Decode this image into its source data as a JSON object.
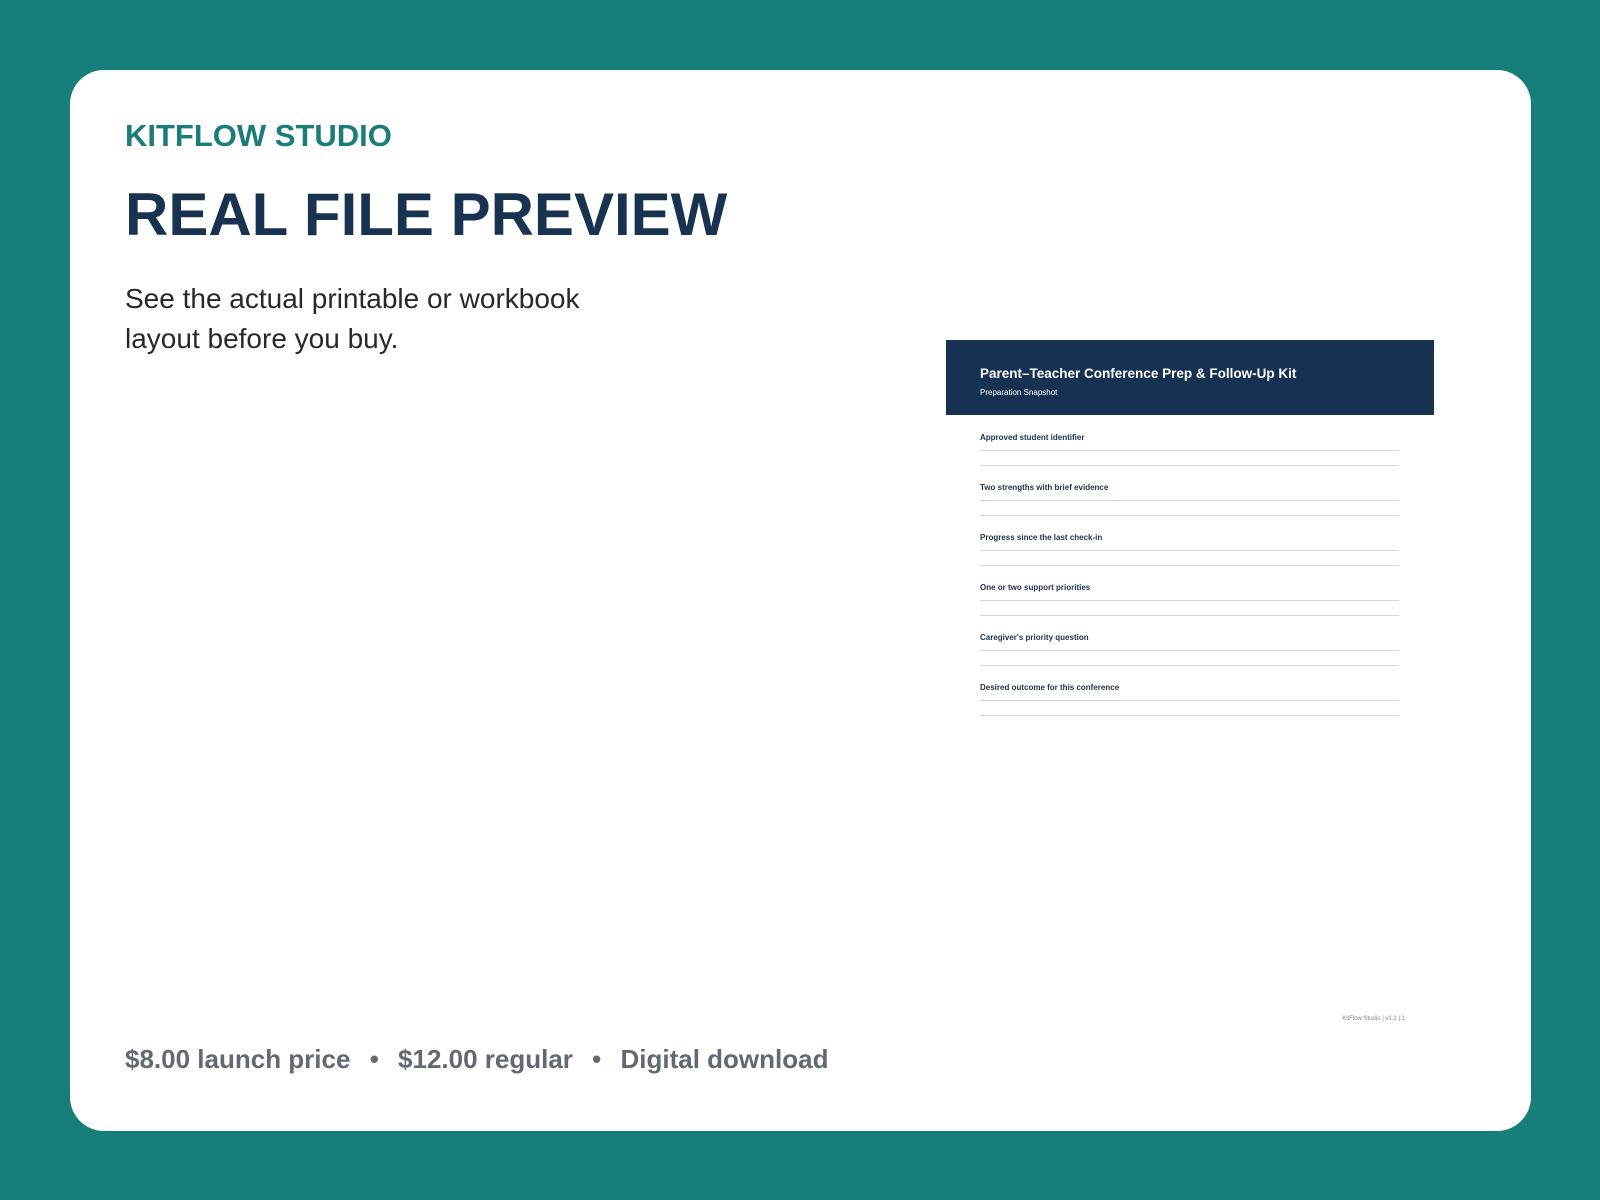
{
  "brand": "KITFLOW STUDIO",
  "headline": "REAL FILE PREVIEW",
  "intro": "See the actual printable or workbook layout before you buy.",
  "preview": {
    "title": "Parent–Teacher Conference Prep & Follow-Up Kit",
    "subtitle": "Preparation Snapshot",
    "fields": [
      "Approved student identifier",
      "Two strengths with brief evidence",
      "Progress since the last check-in",
      "One or two support priorities",
      "Caregiver's priority question",
      "Desired outcome for this conference"
    ],
    "footer": "KitFlow Studio | v1.1 | 1"
  },
  "pricing": {
    "launch": "$8.00 launch price",
    "separator": "•",
    "regular": "$12.00 regular",
    "format": "Digital download"
  },
  "colors": {
    "background": "#167f7a",
    "brand": "#1b7c78",
    "navy": "#19324f",
    "muted": "#626975"
  }
}
